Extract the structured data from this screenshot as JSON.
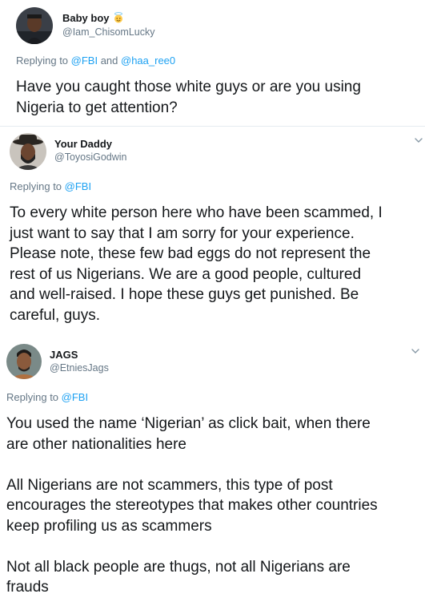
{
  "tweets": [
    {
      "name": "Baby boy",
      "name_emoji": "angel-emoji",
      "handle": "@Iam_ChisomLucky",
      "replying_prefix": "Replying to ",
      "mentions": [
        "@FBI",
        "@haa_ree0"
      ],
      "mention_joiner": " and ",
      "text": "Have you caught those white guys or are you using\nNigeria to get attention?"
    },
    {
      "name": "Your Daddy",
      "handle": "@ToyosiGodwin",
      "replying_prefix": "Replying to ",
      "mentions": [
        "@FBI"
      ],
      "text": "To every white person here who have been scammed, I\njust want to say that I am sorry for your experience.\nPlease note, these few bad eggs do not represent the\nrest of us Nigerians. We are a good people, cultured\nand well-raised. I hope these guys get punished. Be\ncareful, guys."
    },
    {
      "name": "JAGS",
      "handle": "@EtniesJags",
      "replying_prefix": "Replying to ",
      "mentions": [
        "@FBI"
      ],
      "text": "You used the name ‘Nigerian’ as click bait, when there\nare other nationalities here\n\nAll Nigerians are not scammers, this type of post\nencourages the stereotypes that makes other countries\nkeep profiling us as scammers\n\nNot all black people are thugs, not all Nigerians are\nfrauds"
    }
  ],
  "icons": {
    "more": "chevron-down-icon",
    "avatar": "avatar"
  },
  "colors": {
    "link": "#1da1f2",
    "secondary": "#657786",
    "text": "#14171a",
    "divider": "#e6ecf0"
  }
}
